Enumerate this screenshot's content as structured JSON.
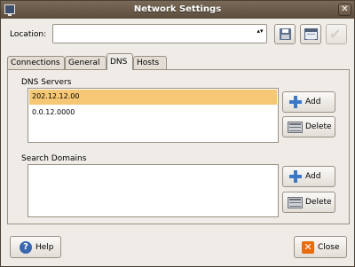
{
  "window": {
    "title": "Network Settings",
    "close_glyph": "✕"
  },
  "location": {
    "label": "Location:",
    "value": "",
    "spinner_glyph": "▴▾"
  },
  "toolbar": {
    "save_icon": "floppy-disk-icon",
    "properties_icon": "properties-icon",
    "apply_icon": "checkmark-icon",
    "apply_glyph": "✔"
  },
  "tabs": [
    {
      "label": "Connections"
    },
    {
      "label": "General"
    },
    {
      "label": "DNS",
      "active": true
    },
    {
      "label": "Hosts"
    }
  ],
  "dns": {
    "servers_label": "DNS Servers",
    "servers": [
      "202.12.12.00",
      "0.0.12.0000"
    ],
    "selected_index": 0,
    "add_label": "Add",
    "delete_label": "Delete",
    "domains_label": "Search Domains",
    "domains": [],
    "add_label_2": "Add",
    "delete_label_2": "Delete"
  },
  "footer": {
    "help_label": "Help",
    "help_glyph": "?",
    "close_label": "Close",
    "close_glyph": "✕"
  },
  "colors": {
    "selection": "#f6c774",
    "accent": "#3a78c8",
    "titlebar": "#5b4c3c",
    "close": "#e96b10"
  }
}
